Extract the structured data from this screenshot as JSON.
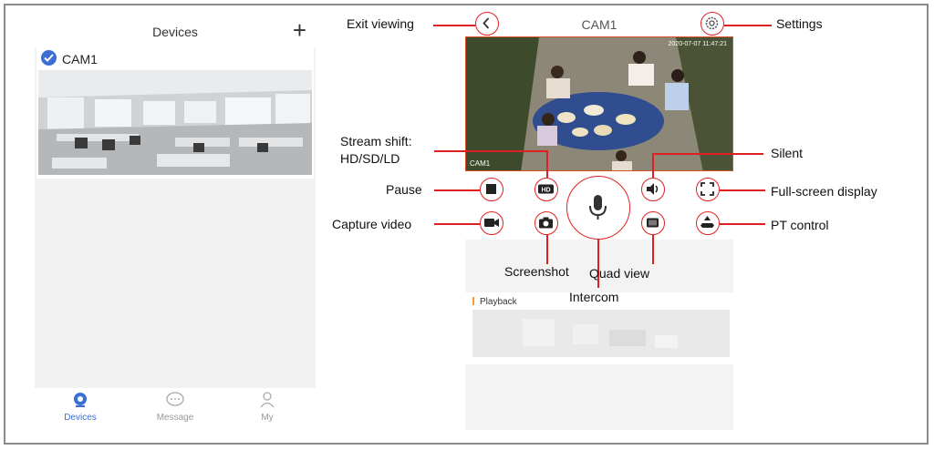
{
  "devices_screen": {
    "title": "Devices",
    "add_icon": "plus-icon",
    "device": {
      "name": "CAM1",
      "selected": true
    },
    "tabs": [
      {
        "label": "Devices",
        "icon": "camera-icon",
        "active": true
      },
      {
        "label": "Message",
        "icon": "chat-icon",
        "active": false
      },
      {
        "label": "My",
        "icon": "person-icon",
        "active": false
      }
    ]
  },
  "live_screen": {
    "title": "CAM1",
    "timestamp": "2020-07-07 11:47:21",
    "video_label": "CAM1",
    "playback_title": "Playback",
    "controls": [
      {
        "name": "pause",
        "icon": "stop-square-icon"
      },
      {
        "name": "stream-shift",
        "icon": "hd-icon",
        "text": "HD"
      },
      {
        "name": "intercom",
        "icon": "microphone-icon"
      },
      {
        "name": "silent",
        "icon": "speaker-icon"
      },
      {
        "name": "full-screen",
        "icon": "expand-icon"
      },
      {
        "name": "capture-video",
        "icon": "video-camera-icon"
      },
      {
        "name": "screenshot",
        "icon": "photo-camera-icon"
      },
      {
        "name": "quad-view",
        "icon": "quad-view-icon"
      },
      {
        "name": "pt-control",
        "icon": "pt-arrows-icon"
      }
    ]
  },
  "annotations": {
    "exit_viewing": "Exit viewing",
    "settings": "Settings",
    "stream_shift_line1": "Stream shift:",
    "stream_shift_line2": "HD/SD/LD",
    "silent": "Silent",
    "pause": "Pause",
    "full_screen": "Full-screen display",
    "capture_video": "Capture video",
    "pt_control": "PT control",
    "screenshot": "Screenshot",
    "quad_view": "Quad view",
    "intercom": "Intercom"
  },
  "colors": {
    "accent": "#3b6fd4",
    "annotation": "#e02020",
    "playback_marker": "#f0a020"
  }
}
